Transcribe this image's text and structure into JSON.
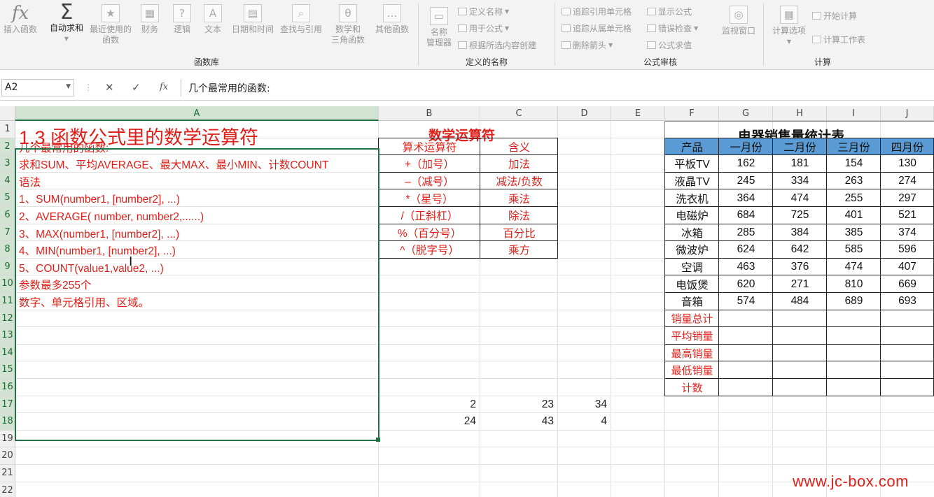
{
  "ribbon": {
    "buttons": [
      {
        "label": "插入函数",
        "icon": "fx-icon"
      },
      {
        "label": "自动求和",
        "icon": "sum-icon"
      },
      {
        "label": "最近使用的\n函数",
        "icon": "star-icon"
      },
      {
        "label": "财务",
        "icon": "finance-icon"
      },
      {
        "label": "逻辑",
        "icon": "logic-icon"
      },
      {
        "label": "文本",
        "icon": "text-icon"
      },
      {
        "label": "日期和时间",
        "icon": "calendar-icon"
      },
      {
        "label": "查找与引用",
        "icon": "lookup-icon"
      },
      {
        "label": "数学和\n三角函数",
        "icon": "theta-icon"
      },
      {
        "label": "其他函数",
        "icon": "more-icon"
      }
    ],
    "name_manager": "名称\n管理器",
    "define_name": "定义名称",
    "use_in_formula": "用于公式",
    "create_from_selection": "根据所选内容创建",
    "trace_precedents": "追踪引用单元格",
    "trace_dependents": "追踪从属单元格",
    "remove_arrows": "删除箭头",
    "show_formulas": "显示公式",
    "error_checking": "错误检查",
    "evaluate_formula": "公式求值",
    "watch_window": "监视窗口",
    "calc_options": "计算选项",
    "calc_now": "开始计算",
    "calc_sheet": "计算工作表",
    "groups": [
      "函数库",
      "定义的名称",
      "公式审核",
      "计算"
    ]
  },
  "formula_bar": {
    "name_box": "A2",
    "content": "几个最常用的函数:"
  },
  "columns": [
    "A",
    "B",
    "C",
    "D",
    "E",
    "F",
    "G",
    "H",
    "I",
    "J"
  ],
  "rows": [
    "1",
    "2",
    "3",
    "4",
    "5",
    "6",
    "7",
    "8",
    "9",
    "10",
    "11",
    "12",
    "13",
    "14",
    "15",
    "16",
    "17",
    "18",
    "19",
    "20",
    "21",
    "22"
  ],
  "sheet": {
    "title": "1.3 函数公式里的数学运算符",
    "a_lines": [
      "几个最常用的函数:",
      "求和SUM、平均AVERAGE、最大MAX、最小MIN、计数COUNT",
      "语法",
      "1、SUM(number1, [number2], ...)",
      "2、AVERAGE( number, number2,......)",
      "3、MAX(number1, [number2], ...)",
      "4、MIN(number1, [number2], ...)",
      "5、COUNT(value1,value2, ...)",
      "参数最多255个",
      "数字、单元格引用、区域。"
    ],
    "operators": {
      "title": "数学运算符",
      "headers": [
        "算术运算符",
        "含义"
      ],
      "rows": [
        [
          "+（加号）",
          "加法"
        ],
        [
          "–（减号）",
          "减法/负数"
        ],
        [
          "*（星号）",
          "乘法"
        ],
        [
          "/（正斜杠）",
          "除法"
        ],
        [
          "%（百分号）",
          "百分比"
        ],
        [
          "^（脱字号）",
          "乘方"
        ]
      ]
    },
    "numbers": {
      "row17": [
        "2",
        "23",
        "34"
      ],
      "row18": [
        "24",
        "43",
        "4"
      ]
    },
    "sales": {
      "title": "电器销售量统计表",
      "headers": [
        "产品",
        "一月份",
        "二月份",
        "三月份",
        "四月份"
      ],
      "rows": [
        [
          "平板TV",
          "162",
          "181",
          "154",
          "130"
        ],
        [
          "液晶TV",
          "245",
          "334",
          "263",
          "274"
        ],
        [
          "洗衣机",
          "364",
          "474",
          "255",
          "297"
        ],
        [
          "电磁炉",
          "684",
          "725",
          "401",
          "521"
        ],
        [
          "冰箱",
          "285",
          "384",
          "385",
          "374"
        ],
        [
          "微波炉",
          "624",
          "642",
          "585",
          "596"
        ],
        [
          "空调",
          "463",
          "376",
          "474",
          "407"
        ],
        [
          "电饭煲",
          "620",
          "271",
          "810",
          "669"
        ],
        [
          "音箱",
          "574",
          "484",
          "689",
          "693"
        ]
      ],
      "summary_labels": [
        "销量总计",
        "平均销量",
        "最高销量",
        "最低销量",
        "计数"
      ]
    }
  },
  "watermark": "www.jc-box.com",
  "colors": {
    "red": "#e0211b",
    "header_blue": "#5b9bd5",
    "selection_green": "#217346"
  }
}
